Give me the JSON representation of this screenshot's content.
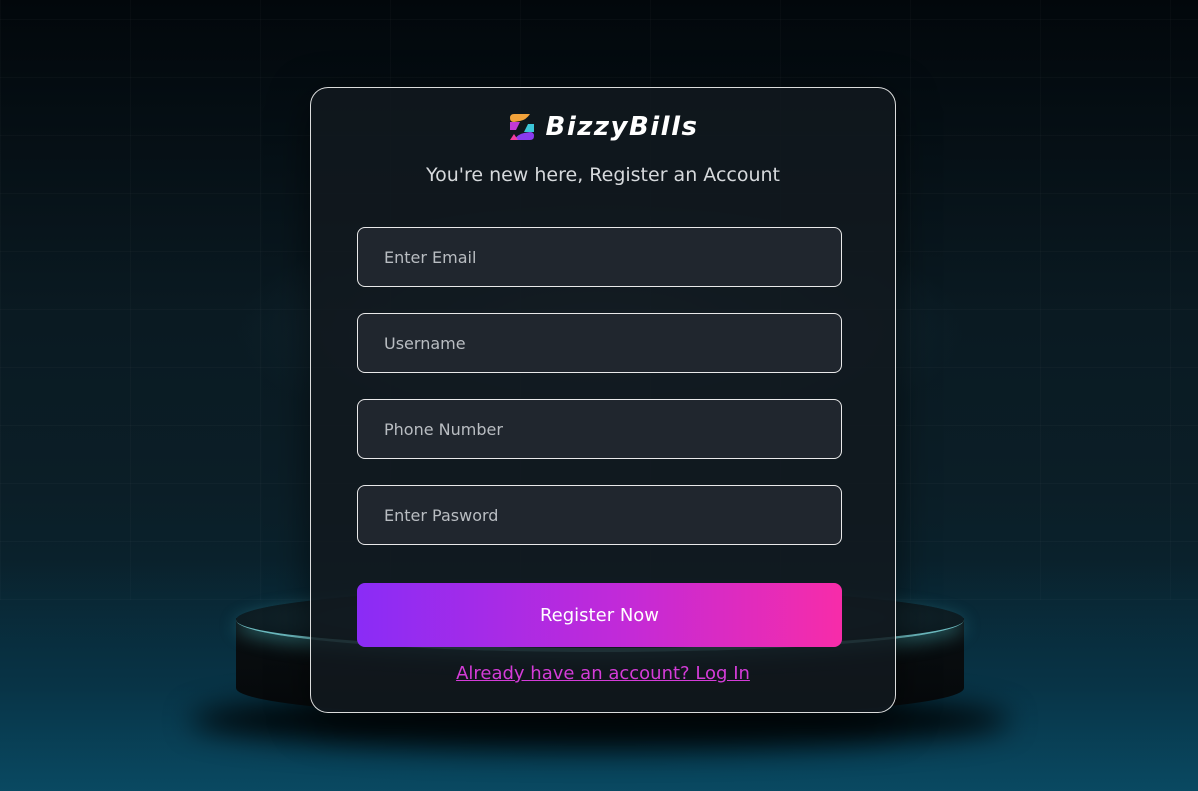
{
  "brand": {
    "name": "BizzyBills",
    "logo_icon": "bizzybills-logo-icon"
  },
  "form": {
    "title": "You're new here, Register an Account",
    "email_placeholder": "Enter Email",
    "username_placeholder": "Username",
    "phone_placeholder": "Phone Number",
    "password_placeholder": "Enter Pasword",
    "submit_label": "Register Now",
    "login_link_text": "Already have an account?  Log In"
  },
  "colors": {
    "button_gradient_start": "#8a2cf6",
    "button_gradient_end": "#f72ca9",
    "link": "#d43cd8",
    "card_border": "#ffffff"
  }
}
